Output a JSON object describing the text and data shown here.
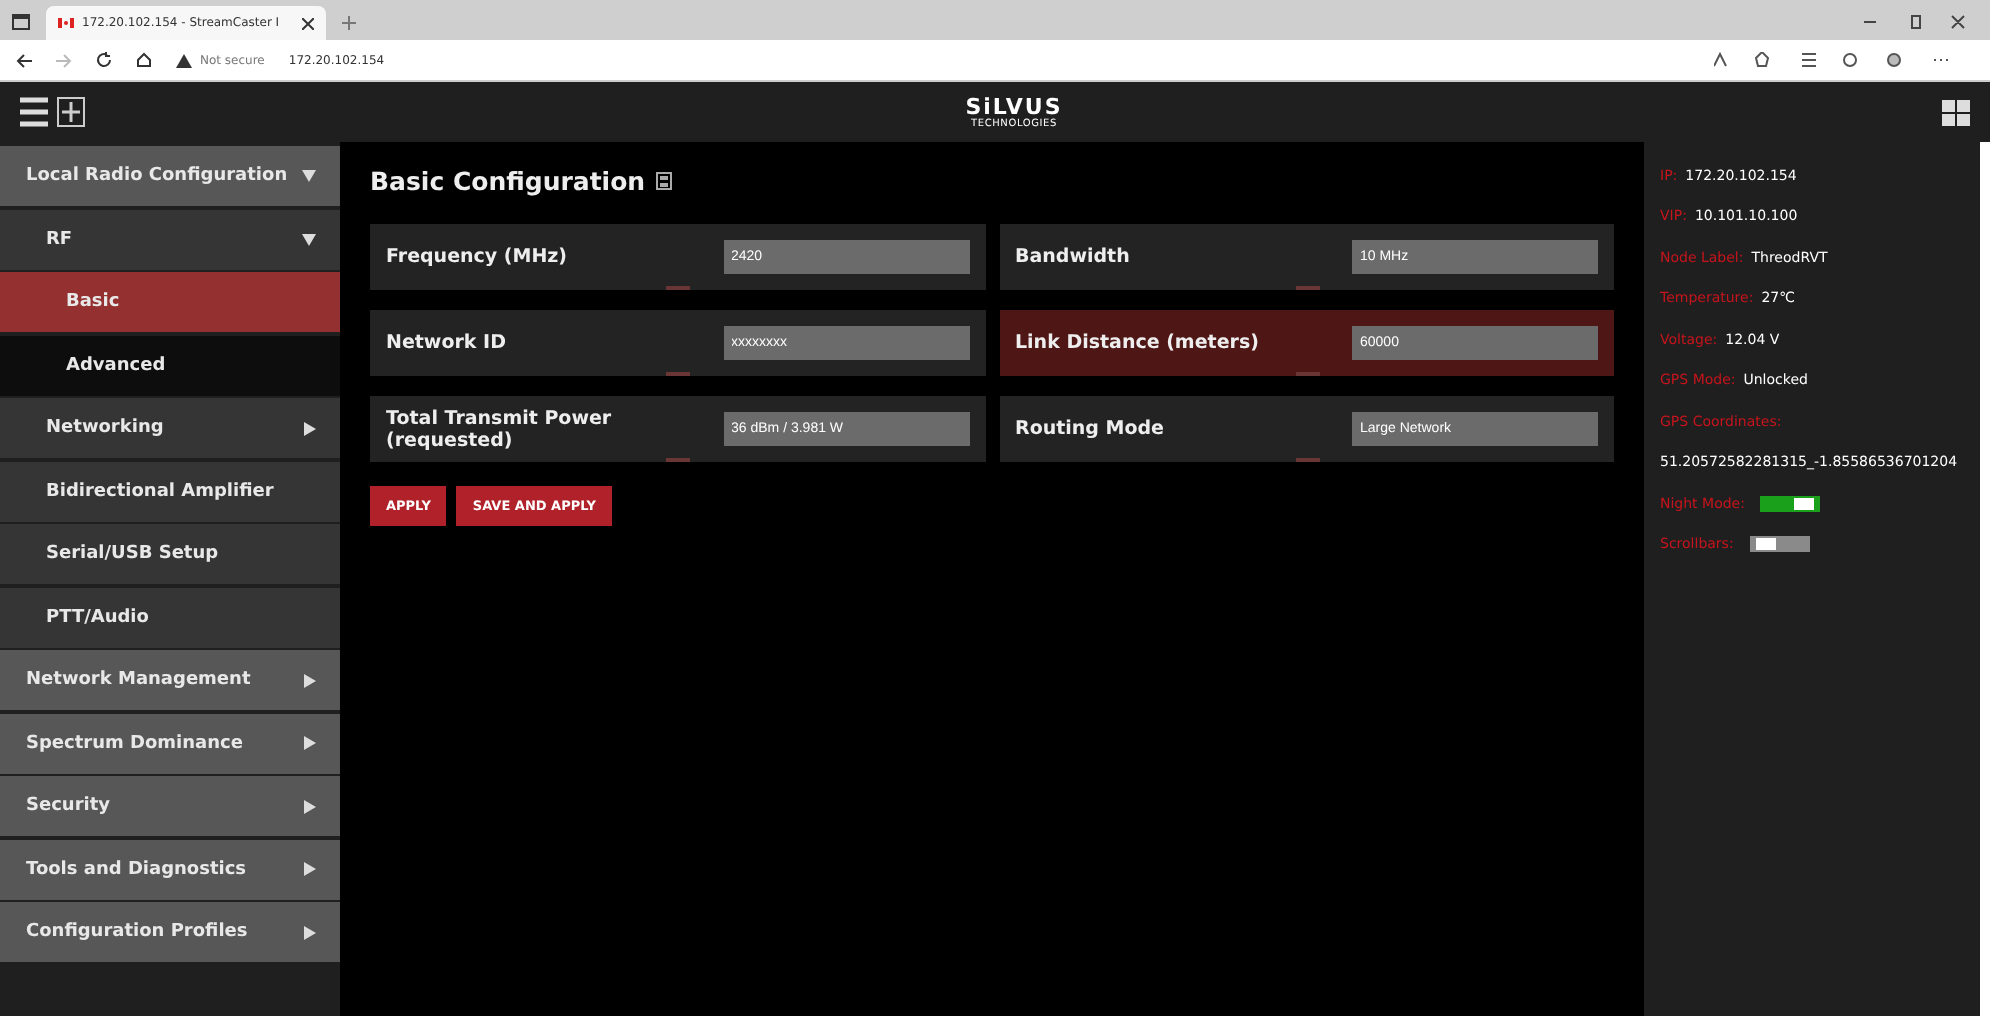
{
  "browser": {
    "tab_title": "172.20.102.154 - StreamCaster I",
    "security": "Not secure",
    "address": "172.20.102.154"
  },
  "header": {
    "logo": "SiLVUS",
    "logo_sub": "TECHNOLOGIES"
  },
  "sidebar": {
    "items": [
      {
        "label": "Local Radio Configuration",
        "expanded": true,
        "selected": false,
        "children": [
          {
            "label": "RF",
            "expanded": true,
            "selected": false,
            "children": [
              {
                "label": "Basic",
                "selected": true
              },
              {
                "label": "Advanced",
                "selected": false
              }
            ]
          },
          {
            "label": "Networking",
            "expanded": false,
            "selected": false
          },
          {
            "label": "Bidirectional Amplifier",
            "selected": false
          },
          {
            "label": "Serial/USB Setup",
            "selected": false
          },
          {
            "label": "PTT/Audio",
            "selected": false
          }
        ]
      },
      {
        "label": "Network Management",
        "expanded": false,
        "selected": false
      },
      {
        "label": "Spectrum Dominance",
        "expanded": false,
        "selected": false
      },
      {
        "label": "Security",
        "expanded": false,
        "selected": false
      },
      {
        "label": "Tools and Diagnostics",
        "expanded": false,
        "selected": false
      },
      {
        "label": "Configuration Profiles",
        "expanded": false,
        "selected": false
      }
    ]
  },
  "main": {
    "title": "Basic Configuration",
    "fields": [
      {
        "label": "Frequency (MHz)",
        "value": "2420",
        "highlighted": false
      },
      {
        "label": "Bandwidth",
        "value": "10 MHz",
        "highlighted": false
      },
      {
        "label": "Network ID",
        "value": "xxxxxxxx",
        "highlighted": false
      },
      {
        "label": "Link Distance (meters)",
        "value": "60000",
        "highlighted": true
      },
      {
        "label": "Total Transmit Power (requested)",
        "value": "36 dBm / 3.981 W",
        "highlighted": false
      },
      {
        "label": "Routing Mode",
        "value": "Large Network",
        "highlighted": false
      }
    ],
    "buttons": [
      "APPLY",
      "SAVE AND APPLY"
    ]
  },
  "status": {
    "items": [
      {
        "kind": "info",
        "label": "IP:",
        "value": "172.20.102.154"
      },
      {
        "kind": "info",
        "label": "VIP:",
        "value": "10.101.10.100"
      },
      {
        "kind": "info",
        "label": "Node Label:",
        "value": "ThreodRVT"
      },
      {
        "kind": "info",
        "label": "Temperature:",
        "value": "27℃"
      },
      {
        "kind": "info",
        "label": "Voltage:",
        "value": "12.04 V"
      },
      {
        "kind": "info",
        "label": "GPS Mode:",
        "value": "Unlocked"
      },
      {
        "kind": "info",
        "label": "GPS Coordinates:"
      },
      {
        "kind": "text",
        "value": "51.20572582281315_-1.85586536701204"
      },
      {
        "kind": "toggle",
        "label": "Night Mode:",
        "on": true
      },
      {
        "kind": "toggle",
        "label": "Scrollbars:",
        "on": false
      }
    ]
  }
}
